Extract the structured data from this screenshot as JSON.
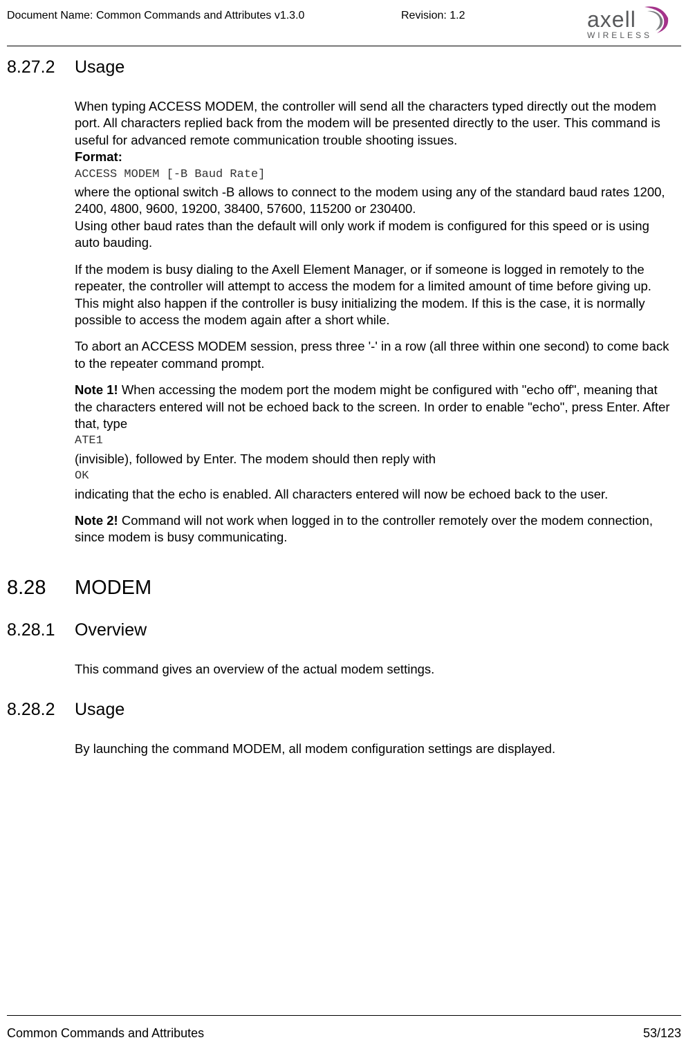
{
  "header": {
    "doc_name_label": "Document Name: Common Commands and Attributes v1.3.0",
    "revision_label": "Revision: 1.2",
    "logo_main": "axell",
    "logo_sub": "WIRELESS"
  },
  "sections": {
    "s8_27_2": {
      "num": "8.27.2",
      "title": "Usage"
    },
    "s8_28": {
      "num": "8.28",
      "title": "MODEM"
    },
    "s8_28_1": {
      "num": "8.28.1",
      "title": "Overview"
    },
    "s8_28_2": {
      "num": "8.28.2",
      "title": "Usage"
    }
  },
  "body": {
    "p1": "When typing ACCESS MODEM, the controller will send all the characters typed directly out the modem port. All characters replied back from the modem will be presented directly to the user. This command is useful for advanced remote communication trouble shooting issues.",
    "format_label": "Format:",
    "code1": "ACCESS MODEM [-B Baud Rate]",
    "p2": "where the optional switch -B allows to connect to the modem using any of the standard baud rates 1200, 2400, 4800, 9600, 19200, 38400, 57600, 115200 or 230400.",
    "p2b": "Using other baud rates than the default will only work if modem is configured for this speed or is using auto bauding.",
    "p3": "If the modem is busy dialing to the Axell Element Manager, or if someone is logged in remotely to the repeater, the controller will attempt to access the modem for a limited amount of time before giving up. This might also happen if the controller is busy initializing the modem. If this is the case, it is normally possible to access the modem again after a short while.",
    "p4": "To abort an ACCESS MODEM session, press three '-' in a row (all three within one second) to come back to the repeater command prompt.",
    "note1_label": "Note 1!",
    "note1_text": " When accessing the modem port the modem might be configured with \"echo off\", meaning that the characters entered will not be echoed back to the screen. In order to enable \"echo\", press Enter. After that, type",
    "code2": "ATE1",
    "p5": "(invisible), followed by Enter. The modem should then reply with",
    "code3": "OK",
    "p6": "indicating that the echo is enabled. All characters entered will now be echoed back to the user.",
    "note2_label": "Note 2!",
    "note2_text": " Command will not work when logged in to the controller remotely over the modem connection, since modem is busy communicating.",
    "overview_p": "This command gives an overview of the actual modem settings.",
    "usage2_p": "By launching the command MODEM, all modem configuration settings are displayed."
  },
  "footer": {
    "left": "Common Commands and Attributes",
    "right": "53/123"
  }
}
